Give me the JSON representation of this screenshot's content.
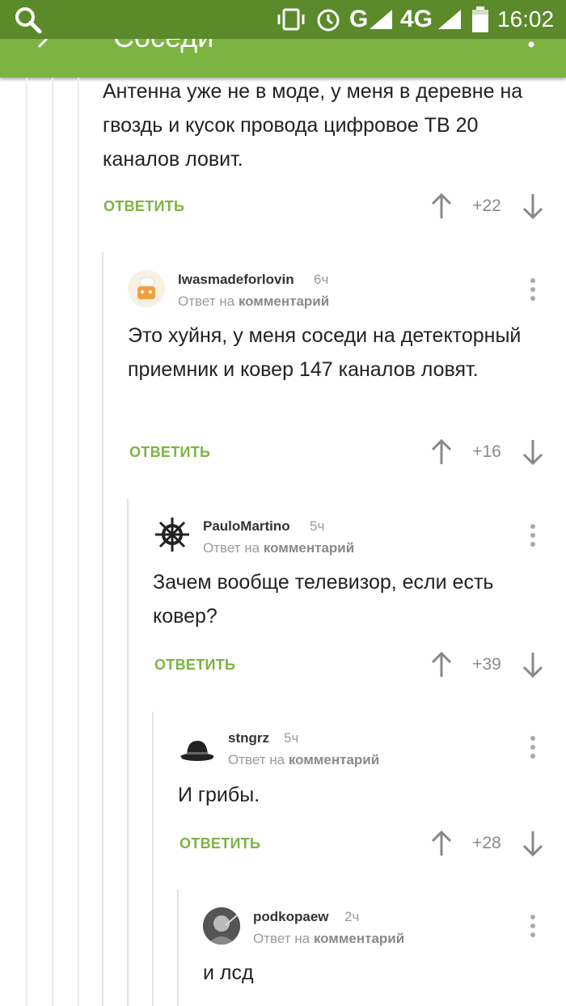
{
  "status_bar": {
    "network": "G",
    "network_4g": "4G",
    "time": "16:02"
  },
  "app_bar": {
    "title": "Соседи"
  },
  "comments": [
    {
      "text": "Антенна уже не в моде, у меня в деревне на гвоздь и кусок провода цифровое ТВ 20 каналов ловит.",
      "reply_label": "ОТВЕТИТЬ",
      "score": "+22"
    },
    {
      "username": "Iwasmadeforlovin",
      "time": "6ч",
      "meta_prefix": "Ответ на",
      "meta_link": "комментарий",
      "text": "Это хуйня, у меня соседи на детекторный приемник и ковер 147 каналов ловят.",
      "reply_label": "ОТВЕТИТЬ",
      "score": "+16"
    },
    {
      "username": "PauloMartino",
      "time": "5ч",
      "meta_prefix": "Ответ на",
      "meta_link": "комментарий",
      "text": "Зачем вообще телевизор, если есть ковер?",
      "reply_label": "ОТВЕТИТЬ",
      "score": "+39"
    },
    {
      "username": "stngrz",
      "time": "5ч",
      "meta_prefix": "Ответ на",
      "meta_link": "комментарий",
      "text": "И грибы.",
      "reply_label": "ОТВЕТИТЬ",
      "score": "+28"
    },
    {
      "username": "podkopaew",
      "time": "2ч",
      "meta_prefix": "Ответ на",
      "meta_link": "комментарий",
      "text": "и лсд"
    }
  ],
  "colors": {
    "status_bar": "#5a8a2a",
    "app_bar": "#7cb342",
    "reply": "#7cb342"
  }
}
